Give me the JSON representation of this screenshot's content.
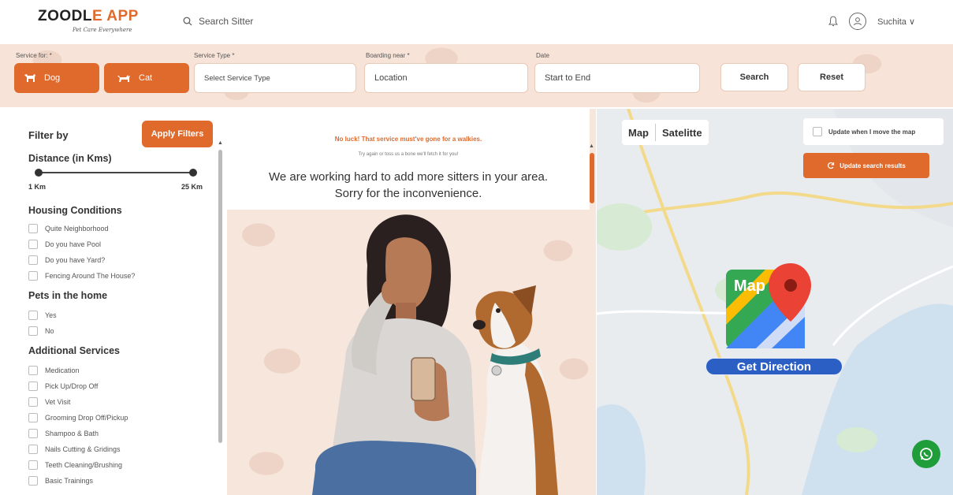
{
  "header": {
    "logo_main_a": "ZOODL",
    "logo_main_b": "E APP",
    "logo_tagline": "Pet Care Everywhere",
    "search_placeholder": "Search Sitter",
    "user_name": "Suchita",
    "user_chevron": "∨"
  },
  "search_bar": {
    "service_for_label": "Service for: *",
    "dog_label": "Dog",
    "cat_label": "Cat",
    "service_type_label": "Service Type *",
    "service_type_value": "Select Service Type",
    "boarding_label": "Boarding near *",
    "boarding_value": "Location",
    "date_label": "Date",
    "date_value": "Start to End",
    "search_label": "Search",
    "reset_label": "Reset"
  },
  "filters": {
    "title": "Filter by",
    "apply_label": "Apply Filters",
    "distance_heading": "Distance (in Kms)",
    "range_min": "1 Km",
    "range_max": "25 Km",
    "housing_heading": "Housing Conditions",
    "housing": [
      "Quite Neighborhood",
      "Do you have Pool",
      "Do you have Yard?",
      "Fencing Around The House?"
    ],
    "pets_heading": "Pets in the home",
    "pets": [
      "Yes",
      "No"
    ],
    "additional_heading": "Additional Services",
    "additional": [
      "Medication",
      "Pick Up/Drop Off",
      "Vet Visit",
      "Grooming Drop Off/Pickup",
      "Shampoo & Bath",
      "Nails Cutting & Gridings",
      "Teeth Cleaning/Brushing",
      "Basic Trainings"
    ]
  },
  "results": {
    "no_luck": "No luck! That service must've gone for a walkies.",
    "try_again": "Try again or toss us a bone we'll fetch it for you!",
    "main_line1": "We are working hard to add more sitters in your area.",
    "main_line2": "Sorry for the inconvenience."
  },
  "map": {
    "tab_map": "Map",
    "tab_satellite": "Satelitte",
    "update_when_move": "Update when I move the map",
    "update_results": "Update search results",
    "map_logo_text": "Map",
    "get_direction": "Get Direction"
  },
  "colors": {
    "brand_orange": "#e06a2c",
    "band_peach": "#f7e3d7",
    "map_blue": "#2b5fc4",
    "whatsapp_green": "#1f9d3a"
  }
}
